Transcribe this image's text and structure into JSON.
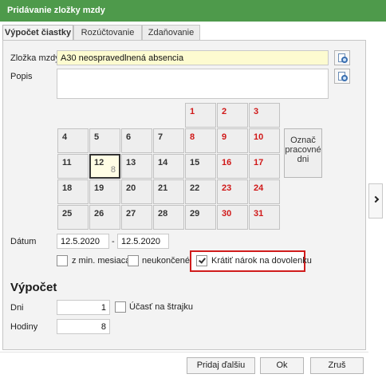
{
  "window": {
    "title": "Pridávanie zložky mzdy"
  },
  "tabs": [
    {
      "label": "Výpočet čiastky",
      "active": true
    },
    {
      "label": "Rozúčtovanie",
      "active": false
    },
    {
      "label": "Zdaňovanie",
      "active": false
    }
  ],
  "form": {
    "zlozka_label": "Zložka mzdy",
    "zlozka_value": "A30  neospravedlnená absencia",
    "popis_label": "Popis",
    "popis_value": "",
    "lookup_icon": "search-document-icon"
  },
  "calendar": {
    "mark_button_label": "Označ pracovné dni",
    "today_sub": "8",
    "weeks": [
      [
        {
          "day": "",
          "red": false
        },
        {
          "day": "",
          "red": false
        },
        {
          "day": "",
          "red": false
        },
        {
          "day": "",
          "red": false
        },
        {
          "day": "1",
          "red": true
        },
        {
          "day": "2",
          "red": true
        },
        {
          "day": "3",
          "red": true
        }
      ],
      [
        {
          "day": "4",
          "red": false
        },
        {
          "day": "5",
          "red": false
        },
        {
          "day": "6",
          "red": false
        },
        {
          "day": "7",
          "red": false
        },
        {
          "day": "8",
          "red": true
        },
        {
          "day": "9",
          "red": true
        },
        {
          "day": "10",
          "red": true
        }
      ],
      [
        {
          "day": "11",
          "red": false
        },
        {
          "day": "12",
          "red": false,
          "today": true
        },
        {
          "day": "13",
          "red": false
        },
        {
          "day": "14",
          "red": false
        },
        {
          "day": "15",
          "red": false
        },
        {
          "day": "16",
          "red": true
        },
        {
          "day": "17",
          "red": true
        }
      ],
      [
        {
          "day": "18",
          "red": false
        },
        {
          "day": "19",
          "red": false
        },
        {
          "day": "20",
          "red": false
        },
        {
          "day": "21",
          "red": false
        },
        {
          "day": "22",
          "red": false
        },
        {
          "day": "23",
          "red": true
        },
        {
          "day": "24",
          "red": true
        }
      ],
      [
        {
          "day": "25",
          "red": false
        },
        {
          "day": "26",
          "red": false
        },
        {
          "day": "27",
          "red": false
        },
        {
          "day": "28",
          "red": false
        },
        {
          "day": "29",
          "red": false
        },
        {
          "day": "30",
          "red": true
        },
        {
          "day": "31",
          "red": true
        }
      ]
    ]
  },
  "datum": {
    "label": "Dátum",
    "from": "12.5.2020",
    "separator": "-",
    "to": "12.5.2020"
  },
  "options": {
    "z_min_mesiaca": {
      "label": "z min. mesiaca",
      "checked": false
    },
    "neukoncene": {
      "label": "neukončené",
      "checked": false
    },
    "kratit": {
      "label": "Krátiť nárok na dovolenku",
      "checked": true
    }
  },
  "vypocet": {
    "title": "Výpočet",
    "dni_label": "Dni",
    "dni_value": "1",
    "strajk_label": "Účasť na štrajku",
    "strajk_checked": false,
    "hodiny_label": "Hodiny",
    "hodiny_value": "8"
  },
  "buttons": {
    "pridaj_dalsiu": "Pridaj ďalšiu",
    "ok": "Ok",
    "zrus": "Zruš"
  },
  "colors": {
    "titlebar": "#4e9a4b",
    "weekend_red": "#d01818",
    "highlight_border": "#d01c1c",
    "input_yellow": "#fdfbd0"
  }
}
